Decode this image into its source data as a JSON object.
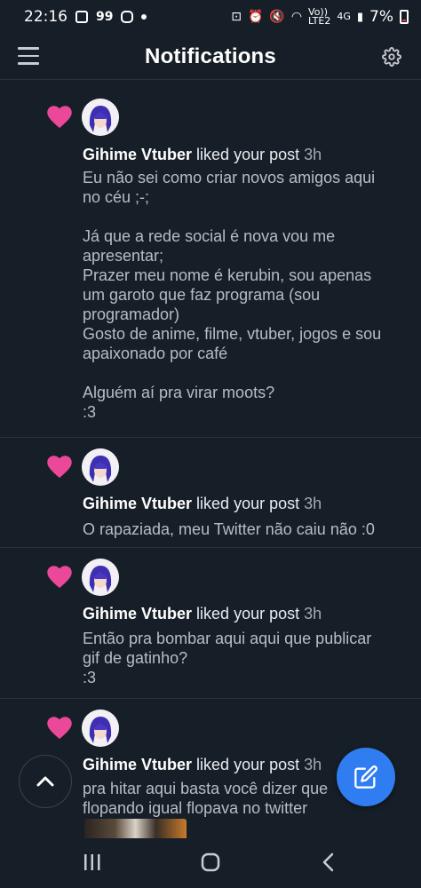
{
  "status_bar": {
    "time": "22:16",
    "network_top": "Vo))",
    "network_bottom": "LTE2",
    "data_type": "4G",
    "battery_percent": "7%"
  },
  "header": {
    "title": "Notifications",
    "menu_icon": "hamburger-menu-icon",
    "settings_icon": "gear-icon"
  },
  "notifications": [
    {
      "user": "Gihime Vtuber",
      "action": "liked your post",
      "time": "3h",
      "text": "Eu não sei como criar novos amigos aqui\nno céu ;-;\n\nJá que a rede social é nova vou me\napresentar;\nPrazer meu nome é kerubin, sou apenas\num garoto que faz programa (sou\nprogramador)\nGosto de anime, filme, vtuber, jogos e sou\napaixonado por café\n\nAlguém aí pra virar moots?\n:3"
    },
    {
      "user": "Gihime Vtuber",
      "action": "liked your post",
      "time": "3h",
      "text": "O rapaziada, meu Twitter não caiu não :0"
    },
    {
      "user": "Gihime Vtuber",
      "action": "liked your post",
      "time": "3h",
      "text": "Então pra bombar aqui aqui que publicar\ngif de gatinho?\n:3"
    },
    {
      "user": "Gihime Vtuber",
      "action": "liked your post",
      "time": "3h",
      "text": "pra hitar aqui basta você dizer que\nflopando igual flopava no twitter"
    }
  ],
  "colors": {
    "background": "#161e27",
    "heart": "#ec4899",
    "accent": "#2f7df0",
    "divider": "#2b343e"
  }
}
